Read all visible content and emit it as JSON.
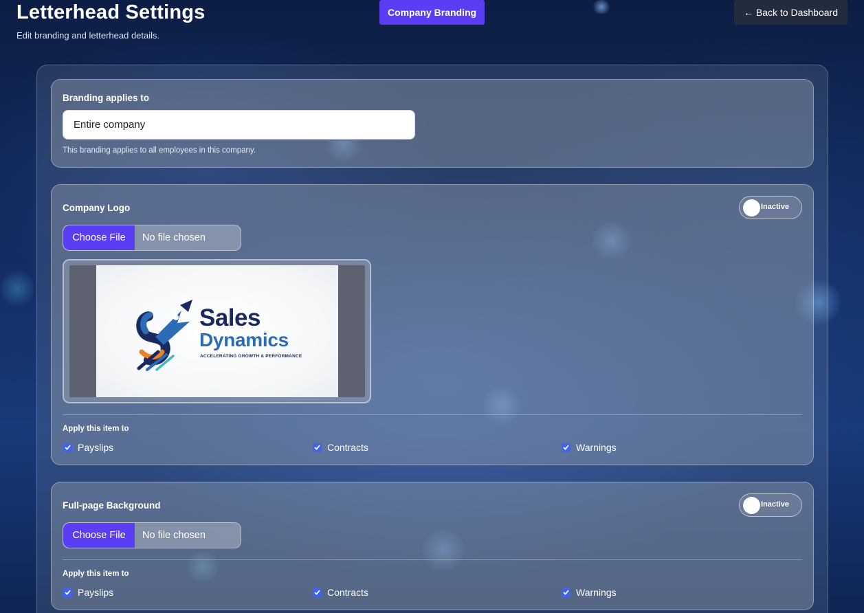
{
  "header": {
    "title": "Letterhead Settings",
    "subtitle": "Edit branding and letterhead details.",
    "company_branding_label": "Company Branding",
    "back_label": "← Back to Dashboard"
  },
  "scope": {
    "heading": "Branding applies to",
    "value": "Entire company",
    "hint": "This branding applies to all employees in this company."
  },
  "logo_section": {
    "heading": "Company Logo",
    "toggle_label": "Inactive",
    "choose_file_label": "Choose File",
    "no_file_label": "No file chosen",
    "preview": {
      "name_line_1": "Sales",
      "name_line_2": "Dynamics",
      "tagline": "ACCELERATING GROWTH & PERFORMANCE"
    },
    "apply_label": "Apply this item to",
    "options": [
      {
        "label": "Payslips",
        "checked": true
      },
      {
        "label": "Contracts",
        "checked": true
      },
      {
        "label": "Warnings",
        "checked": true
      }
    ]
  },
  "background_section": {
    "heading": "Full-page Background",
    "toggle_label": "Inactive",
    "choose_file_label": "Choose File",
    "no_file_label": "No file chosen",
    "apply_label": "Apply this item to",
    "options": [
      {
        "label": "Payslips",
        "checked": true
      },
      {
        "label": "Contracts",
        "checked": true
      },
      {
        "label": "Warnings",
        "checked": true
      }
    ]
  },
  "colors": {
    "accent": "#5b3ef3",
    "checkbox": "#3e63f0",
    "back_button": "#232c3f",
    "logo_navy": "#1a2a5e",
    "logo_blue": "#2c6bb6",
    "logo_orange": "#e8822a"
  },
  "icons": [
    "check-icon",
    "toggle-knob",
    "logo-rocket-mark"
  ]
}
